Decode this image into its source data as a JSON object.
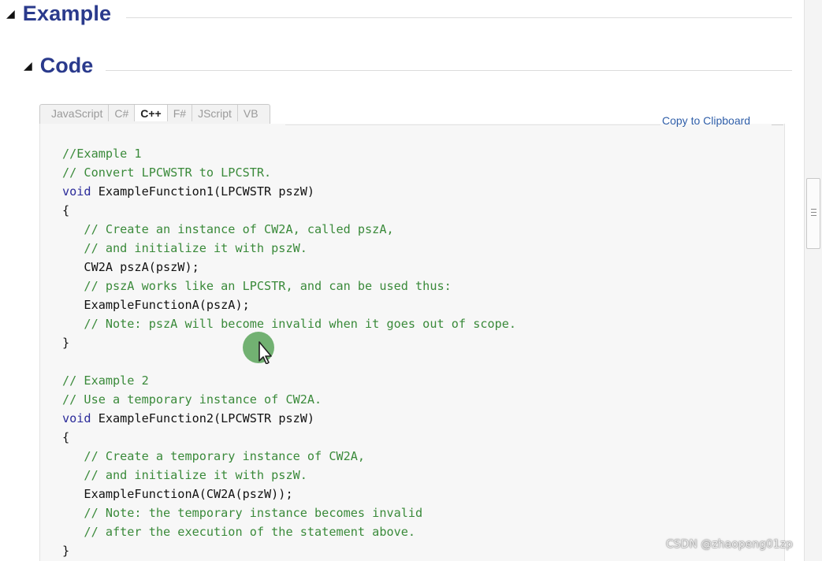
{
  "headings": {
    "example": "Example",
    "code": "Code"
  },
  "tabs": [
    {
      "label": "JavaScript",
      "active": false
    },
    {
      "label": "C#",
      "active": false
    },
    {
      "label": "C++",
      "active": true
    },
    {
      "label": "F#",
      "active": false
    },
    {
      "label": "JScript",
      "active": false
    },
    {
      "label": "VB",
      "active": false
    }
  ],
  "copy_label": "Copy to Clipboard",
  "code_lines": [
    [
      {
        "t": "c",
        "s": "//Example 1"
      }
    ],
    [
      {
        "t": "c",
        "s": "// Convert LPCWSTR to LPCSTR."
      }
    ],
    [
      {
        "t": "k",
        "s": "void"
      },
      {
        "t": "x",
        "s": " ExampleFunction1(LPCWSTR pszW)"
      }
    ],
    [
      {
        "t": "x",
        "s": "{"
      }
    ],
    [
      {
        "t": "c",
        "s": "   // Create an instance of CW2A, called pszA,"
      }
    ],
    [
      {
        "t": "c",
        "s": "   // and initialize it with pszW."
      }
    ],
    [
      {
        "t": "x",
        "s": "   CW2A pszA(pszW);"
      }
    ],
    [
      {
        "t": "c",
        "s": "   // pszA works like an LPCSTR, and can be used thus:"
      }
    ],
    [
      {
        "t": "x",
        "s": "   ExampleFunctionA(pszA);"
      }
    ],
    [
      {
        "t": "c",
        "s": "   // Note: pszA will become invalid when it goes out of scope."
      }
    ],
    [
      {
        "t": "x",
        "s": "}"
      }
    ],
    [
      {
        "t": "x",
        "s": ""
      }
    ],
    [
      {
        "t": "c",
        "s": "// Example 2"
      }
    ],
    [
      {
        "t": "c",
        "s": "// Use a temporary instance of CW2A."
      }
    ],
    [
      {
        "t": "k",
        "s": "void"
      },
      {
        "t": "x",
        "s": " ExampleFunction2(LPCWSTR pszW)"
      }
    ],
    [
      {
        "t": "x",
        "s": "{"
      }
    ],
    [
      {
        "t": "c",
        "s": "   // Create a temporary instance of CW2A,"
      }
    ],
    [
      {
        "t": "c",
        "s": "   // and initialize it with pszW."
      }
    ],
    [
      {
        "t": "x",
        "s": "   ExampleFunctionA(CW2A(pszW));"
      }
    ],
    [
      {
        "t": "c",
        "s": "   // Note: the temporary instance becomes invalid"
      }
    ],
    [
      {
        "t": "c",
        "s": "   // after the execution of the statement above."
      }
    ],
    [
      {
        "t": "x",
        "s": "}"
      }
    ]
  ],
  "watermark": "CSDN @zhaopeng01zp",
  "colors": {
    "heading": "#2a3a8c",
    "comment": "#3a8a3a",
    "keyword": "#2b2b9a",
    "link": "#2f5ea8"
  },
  "icons": {
    "collapse": "triangle-down-icon",
    "cursor": "mouse-pointer-icon"
  }
}
